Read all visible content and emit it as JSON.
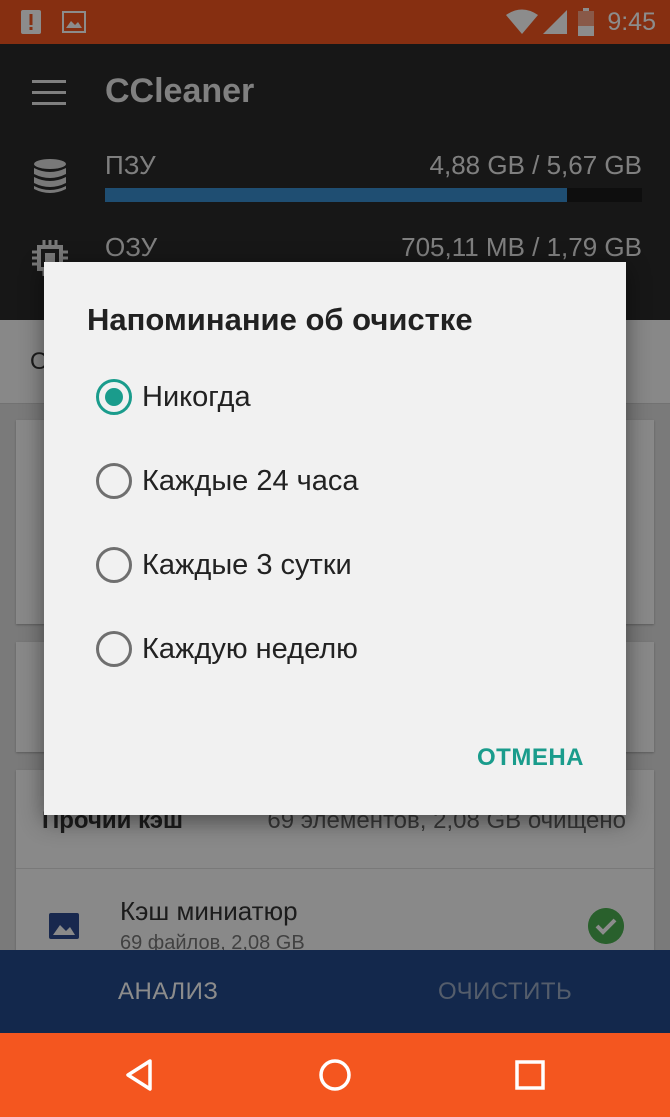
{
  "status_bar": {
    "time": "9:45",
    "icons": [
      "alert-notification-icon",
      "image-notification-icon",
      "wifi-icon",
      "cell-signal-icon",
      "battery-low-icon"
    ]
  },
  "header": {
    "title": "CCleaner",
    "rom": {
      "label": "ПЗУ",
      "value": "4,88 GB / 5,67 GB",
      "fraction": 0.861
    },
    "ram": {
      "label": "ОЗУ",
      "value": "705,11 MB / 1,79 GB"
    }
  },
  "content": {
    "toolbar_peek": "О",
    "cache_header": "Прочий кэш",
    "cache_summary": "69 элементов, 2,08 GB очищено",
    "thumbnail_title": "Кэш миниатюр",
    "thumbnail_sub": "69 файлов, 2,08 GB"
  },
  "bottom_actions": {
    "analyze": "АНАЛИЗ",
    "clean": "ОЧИСТИТЬ"
  },
  "dialog": {
    "title": "Напоминание об очистке",
    "options": [
      {
        "label": "Никогда",
        "selected": true
      },
      {
        "label": "Каждые 24 часа",
        "selected": false
      },
      {
        "label": "Каждые 3 сутки",
        "selected": false
      },
      {
        "label": "Каждую неделю",
        "selected": false
      }
    ],
    "cancel": "ОТМЕНА"
  },
  "colors": {
    "accent": "#1a9c8c",
    "status_bar": "#f4561f",
    "header_bg": "#2b2b2b",
    "progress": "#3a8fd0",
    "action_bar": "#234a8a",
    "check": "#4caf50"
  }
}
